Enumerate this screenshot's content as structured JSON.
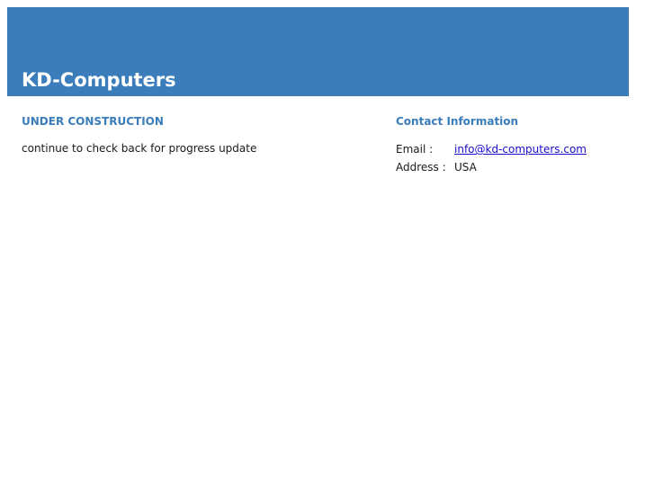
{
  "header": {
    "site_title": "KD-Computers",
    "background_color": "#3b7dbb"
  },
  "main": {
    "heading": "UNDER CONSTRUCTION",
    "message": "continue to check back for progress update"
  },
  "contact": {
    "heading": "Contact Information",
    "email_label": "Email :",
    "email_value": "info@kd-computers.com",
    "address_label": "Address :",
    "address_value": "USA"
  },
  "colors": {
    "accent": "#3b7dbb",
    "link": "#1a0dcc",
    "text": "#1a1a1a"
  }
}
